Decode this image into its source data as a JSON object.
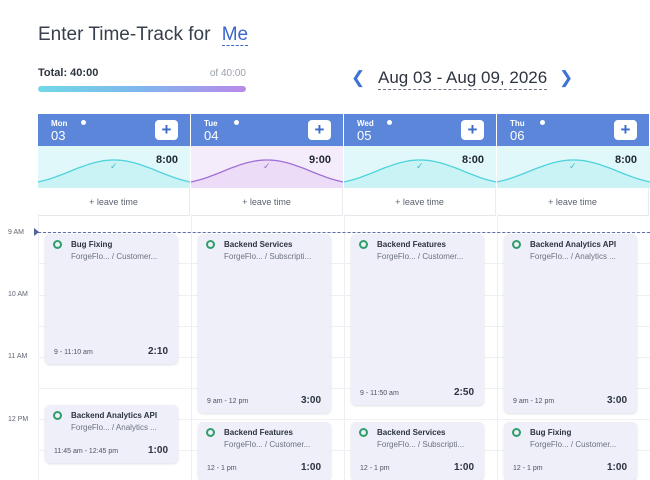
{
  "header": {
    "title_prefix": "Enter Time-Track for",
    "user": "Me"
  },
  "summary": {
    "total_label": "Total: 40:00",
    "of_label": "of 40:00",
    "progress_percent": 100
  },
  "week_nav": {
    "prev_icon": "chevron-left-icon",
    "next_icon": "chevron-right-icon",
    "range": "Aug 03 - Aug 09, 2026"
  },
  "days": [
    {
      "name": "Mon",
      "num": "03",
      "hours": "8:00",
      "leave": "+ leave time",
      "wave_color": "#c9f3f5",
      "wave_stroke": "#4fd3dc",
      "check_color": "#3fbfca"
    },
    {
      "name": "Tue",
      "num": "04",
      "hours": "9:00",
      "leave": "+ leave time",
      "wave_color": "#eddcf8",
      "wave_stroke": "#a06fd6",
      "check_color": "#9b6ed3"
    },
    {
      "name": "Wed",
      "num": "05",
      "hours": "8:00",
      "leave": "+ leave time",
      "wave_color": "#c9f3f5",
      "wave_stroke": "#4fd3dc",
      "check_color": "#3fbfca"
    },
    {
      "name": "Thu",
      "num": "06",
      "hours": "8:00",
      "leave": "+ leave time",
      "wave_color": "#c9f3f5",
      "wave_stroke": "#4fd3dc",
      "check_color": "#3fbfca"
    }
  ],
  "add_label": "+",
  "time_labels": [
    "9 AM",
    "10 AM",
    "11 AM",
    "12 PM"
  ],
  "entries": [
    {
      "title": "Bug Fixing",
      "project": "ForgeFlo...",
      "category": "/ Customer...",
      "time": "9 - 11:10 am",
      "duration": "2:10"
    },
    {
      "title": "Backend Analytics API",
      "project": "ForgeFlo...",
      "category": "/ Analytics ...",
      "time": "11:45 am - 12:45 pm",
      "duration": "1:00"
    },
    {
      "title": "Backend Services",
      "project": "ForgeFlo...",
      "category": "/ Subscripti...",
      "time": "9 am - 12 pm",
      "duration": "3:00"
    },
    {
      "title": "Backend Features",
      "project": "ForgeFlo...",
      "category": "/ Customer...",
      "time": "12 - 1 pm",
      "duration": "1:00"
    },
    {
      "title": "Backend Features",
      "project": "ForgeFlo...",
      "category": "/ Customer...",
      "time": "9 - 11:50 am",
      "duration": "2:50"
    },
    {
      "title": "Backend Services",
      "project": "ForgeFlo...",
      "category": "/ Subscripti...",
      "time": "12 - 1 pm",
      "duration": "1:00"
    },
    {
      "title": "Backend Analytics API",
      "project": "ForgeFlo...",
      "category": "/ Analytics ...",
      "time": "9 am - 12 pm",
      "duration": "3:00"
    },
    {
      "title": "Bug Fixing",
      "project": "ForgeFlo...",
      "category": "/ Customer...",
      "time": "12 - 1 pm",
      "duration": "1:00"
    }
  ],
  "colors": {
    "header_blue": "#5c86d9",
    "accent": "#3b67c8",
    "card_bg": "#eeeff8",
    "status_green": "#2f9e6a"
  }
}
